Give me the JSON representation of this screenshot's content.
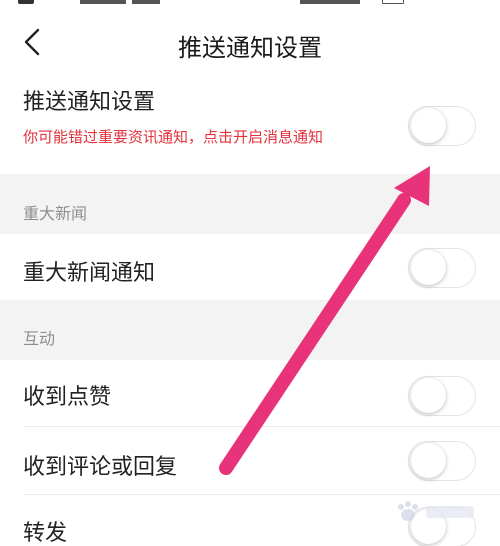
{
  "header": {
    "title": "推送通知设置"
  },
  "push_setting": {
    "label": "推送通知设置",
    "hint": "你可能错过重要资讯通知，点击开启消息通知",
    "enabled": false
  },
  "sections": [
    {
      "title": "重大新闻",
      "items": [
        {
          "label": "重大新闻通知",
          "enabled": false
        }
      ]
    },
    {
      "title": "互动",
      "items": [
        {
          "label": "收到点赞",
          "enabled": false
        },
        {
          "label": "收到评论或回复",
          "enabled": false
        },
        {
          "label": "转发",
          "enabled": false
        }
      ]
    }
  ],
  "overlay": {
    "arrow_color": "#e8327a",
    "icon": "arrow-icon"
  },
  "colors": {
    "hint_red": "#e2323b",
    "section_bg": "#f3f3f3",
    "toggle_off_border": "#e4e4e4"
  },
  "watermark": {
    "icon": "baidu-logo-icon"
  }
}
